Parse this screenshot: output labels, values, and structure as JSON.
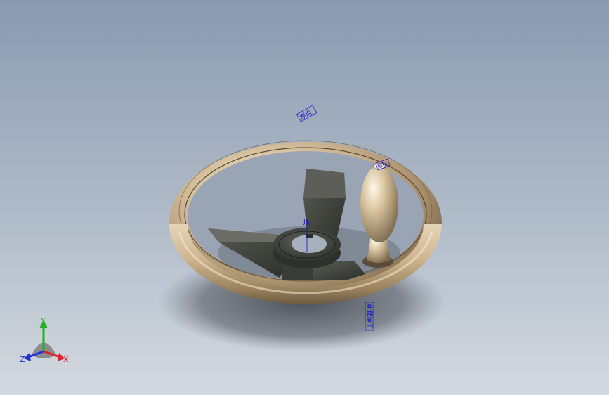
{
  "viewport": {
    "background_top": "#8a9bb0",
    "background_bottom": "#d3d9e0"
  },
  "model": {
    "rim_color": "#d8c3a0",
    "spoke_color": "#4a4c46",
    "hub_color": "#43453f",
    "handle_color": "#d2bd98"
  },
  "annotations": {
    "top_label": "原点",
    "hub_marker": "J",
    "handle_label": "前视",
    "bottom_label": "上视基准",
    "color": "#1010d0"
  },
  "triad": {
    "x_label": "X",
    "y_label": "Y",
    "z_label": "Z",
    "x_color": "#e0202a",
    "y_color": "#20b020",
    "z_color": "#2030e0"
  }
}
